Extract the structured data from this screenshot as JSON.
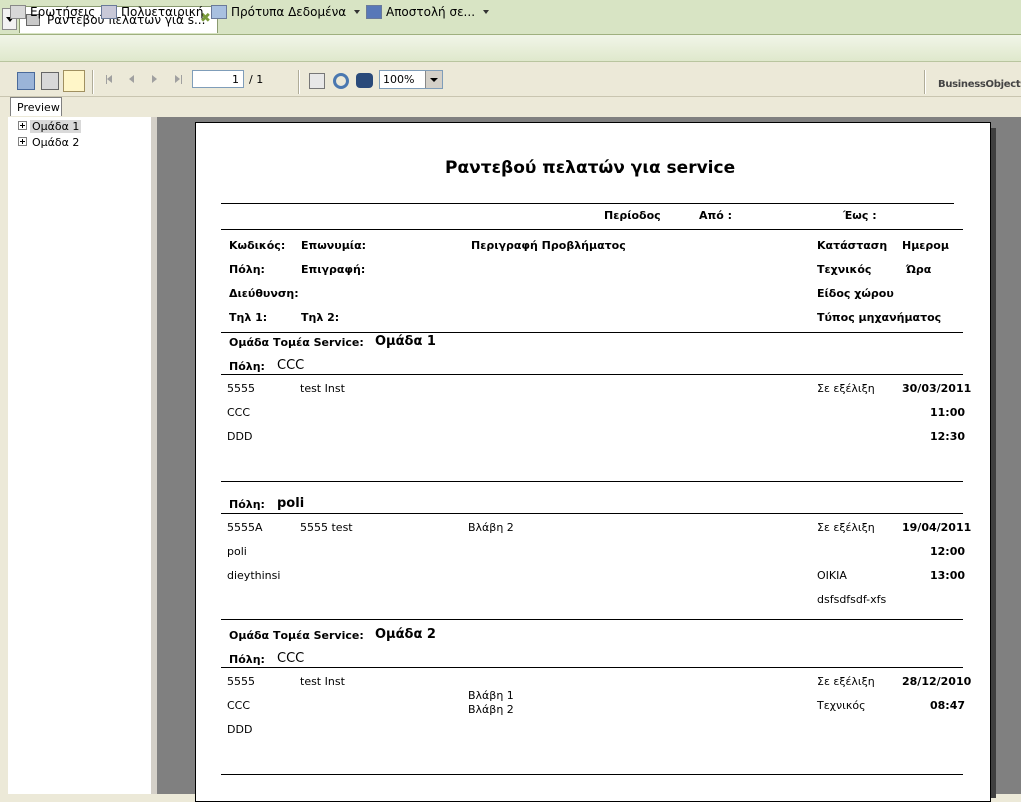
{
  "tab": {
    "title": "Ραντεβού πελατών για s..."
  },
  "menu": {
    "items": [
      {
        "label": "Ερωτήσεις"
      },
      {
        "label": "Πολυεταιρική"
      },
      {
        "label": "Πρότυπα Δεδομένα"
      },
      {
        "label": "Αποστολή σε..."
      }
    ]
  },
  "viewer": {
    "page_current": "1",
    "page_total": "/ 1",
    "zoom": "100%",
    "logo": "BusinessObjects",
    "preview_tab": "Preview"
  },
  "tree": {
    "nodes": [
      "Ομάδα 1",
      "Ομάδα 2"
    ]
  },
  "report": {
    "title": "Ραντεβού πελατών για service",
    "period": {
      "label": "Περίοδος",
      "from": "Από :",
      "to": "Έως :"
    },
    "headers": {
      "code": "Κωδικός:",
      "surname": "Επωνυμία:",
      "problem": "Περιγραφή Προβλήματος",
      "status": "Κατάσταση",
      "date": "Ημερομ",
      "city": "Πόλη:",
      "title": "Επιγραφή:",
      "technician": "Τεχνικός",
      "time": "Ώρα",
      "address": "Διεύθυνση:",
      "space_type": "Είδος χώρου",
      "tel1": "Τηλ 1:",
      "tel2": "Τηλ 2:",
      "machine_type": "Τύπος μηχανήματος"
    },
    "group_label": "Ομάδα Τομέα Service:",
    "city_label": "Πόλη:",
    "groups": [
      {
        "name": "Ομάδα 1",
        "cities": [
          {
            "name": "CCC",
            "rec": {
              "code": "5555",
              "surname": "test Inst",
              "problem": "",
              "status": "Σε εξέλιξη",
              "date": "30/03/2011",
              "city": "CCC",
              "time1": "11:00",
              "address": "DDD",
              "time2": "12:30",
              "space": "",
              "machine": ""
            }
          },
          {
            "name": "poli",
            "rec": {
              "code": "5555A",
              "surname": "5555 test",
              "problem": "Βλάβη 2",
              "status": "Σε εξέλιξη",
              "date": "19/04/2011",
              "city": "poli",
              "time1": "12:00",
              "address": "dieythinsi",
              "time2": "13:00",
              "space": "OIKIA",
              "machine": "dsfsdfsdf-xfs"
            }
          }
        ]
      },
      {
        "name": "Ομάδα 2",
        "cities": [
          {
            "name": "CCC",
            "rec": {
              "code": "5555",
              "surname": "test Inst",
              "problem1": "Βλάβη 1",
              "problem2": "Βλάβη 2",
              "status": "Σε εξέλιξη",
              "date": "28/12/2010",
              "city": "CCC",
              "technician": "Τεχνικός",
              "time1": "08:47",
              "address": "DDD"
            }
          }
        ]
      }
    ]
  }
}
